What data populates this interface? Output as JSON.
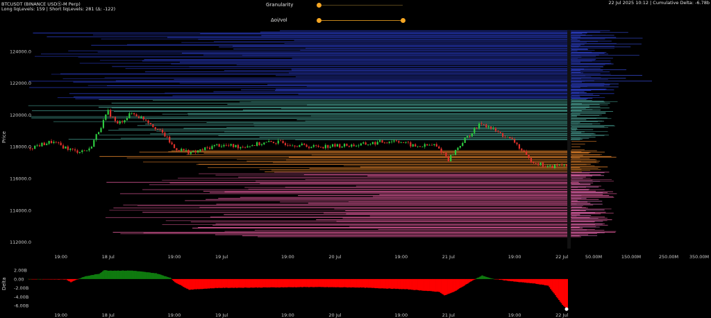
{
  "header": {
    "symbol": "BTCUSDT (BINANCE USDⓈ-M Perp)",
    "liq_levels": "Long liqLevels: 159 | Short liqLevels: 281 (Δ: -122)",
    "timestamp_delta": "22 Jul 2025 10:12 | Cumulative Delta: -6.78b"
  },
  "controls": {
    "granularity_label": "Granularity",
    "granularity_value": 0.0,
    "oi_vol_label": "Δoi/vol",
    "oi_vol_range": [
      0.0,
      1.0
    ]
  },
  "colors": {
    "background": "#000000",
    "up_candle": "#2ecc40",
    "down_candle": "#e0312b",
    "delta_positive": "#0f7a0f",
    "delta_negative": "#ff0000",
    "slider": "#f5a623"
  },
  "chart_data": [
    {
      "type": "candlestick",
      "ylabel": "Price",
      "y_ticks": [
        "124000.0",
        "122000.0",
        "120000.0",
        "118000.0",
        "116000.0",
        "114000.0",
        "112000.0"
      ],
      "y_tick_values": [
        124000,
        122000,
        120000,
        118000,
        116000,
        114000,
        112000
      ],
      "ylim": [
        111500,
        125300
      ],
      "x_ticks": [
        "19:00",
        "18 Jul",
        "19:00",
        "19 Jul",
        "19:00",
        "20 Jul",
        "19:00",
        "21 Jul",
        "19:00",
        "22 Jul"
      ],
      "x_tick_hours": [
        7,
        17,
        31,
        41,
        55,
        65,
        79,
        89,
        103,
        113
      ],
      "x_start": "17 Jul 2025 12:00",
      "x_end": "22 Jul 2025 10:00",
      "price_path_hours": [
        0,
        5,
        10,
        13,
        17,
        19,
        22,
        25,
        29,
        31,
        35,
        40,
        45,
        52,
        60,
        70,
        78,
        82,
        86,
        88,
        89,
        92,
        96,
        100,
        103,
        106,
        110,
        114
      ],
      "price_path_values": [
        117900,
        118300,
        117700,
        117800,
        120200,
        119400,
        120100,
        119700,
        118700,
        117900,
        117600,
        118100,
        118000,
        118300,
        118000,
        118100,
        118400,
        118000,
        118100,
        117600,
        117200,
        118300,
        119500,
        118800,
        118300,
        117200,
        116700,
        116900
      ],
      "volume_profile_axis": [
        "50.00M",
        "150.00M",
        "250.00M",
        "350.00M"
      ],
      "volume_profile_values": [
        50000000,
        150000000,
        250000000,
        350000000
      ],
      "liquidation_bands": [
        {
          "name": "long",
          "from": 112300,
          "to": 116400,
          "color": "#e05a9a"
        },
        {
          "name": "near-long",
          "from": 116400,
          "to": 117800,
          "color": "#e4842c"
        },
        {
          "name": "near-short",
          "from": 118400,
          "to": 121000,
          "color": "#4aa89a"
        },
        {
          "name": "short",
          "from": 121000,
          "to": 125300,
          "color": "#2a3cc8"
        }
      ]
    },
    {
      "type": "area",
      "ylabel": "Delta",
      "y_ticks": [
        "2.00B",
        "0.00",
        "-2.00B",
        "-4.00B",
        "-6.00B"
      ],
      "y_tick_values": [
        2,
        0,
        -2,
        -4,
        -6
      ],
      "ylim": [
        -6.9,
        2.8
      ],
      "x_ticks": [
        "19:00",
        "18 Jul",
        "19:00",
        "19 Jul",
        "19:00",
        "20 Jul",
        "19:00",
        "21 Jul",
        "19:00",
        "22 Jul"
      ],
      "delta_path_hours": [
        0,
        8,
        9,
        10,
        12,
        15,
        16,
        17,
        22,
        27,
        30,
        31,
        34,
        40,
        50,
        60,
        70,
        80,
        87,
        88,
        90,
        94,
        96,
        98,
        103,
        107,
        110,
        113,
        114
      ],
      "delta_path_values": [
        0,
        -0.1,
        -0.7,
        -0.2,
        0.6,
        1.2,
        2.0,
        1.9,
        1.9,
        1.3,
        0.3,
        -0.7,
        -2.4,
        -2.0,
        -1.9,
        -1.8,
        -1.9,
        -2.3,
        -2.9,
        -3.7,
        -2.9,
        -0.3,
        0.8,
        0.1,
        -0.6,
        -1.0,
        -1.5,
        -5.8,
        -6.78
      ],
      "last_value": -6.78
    }
  ]
}
